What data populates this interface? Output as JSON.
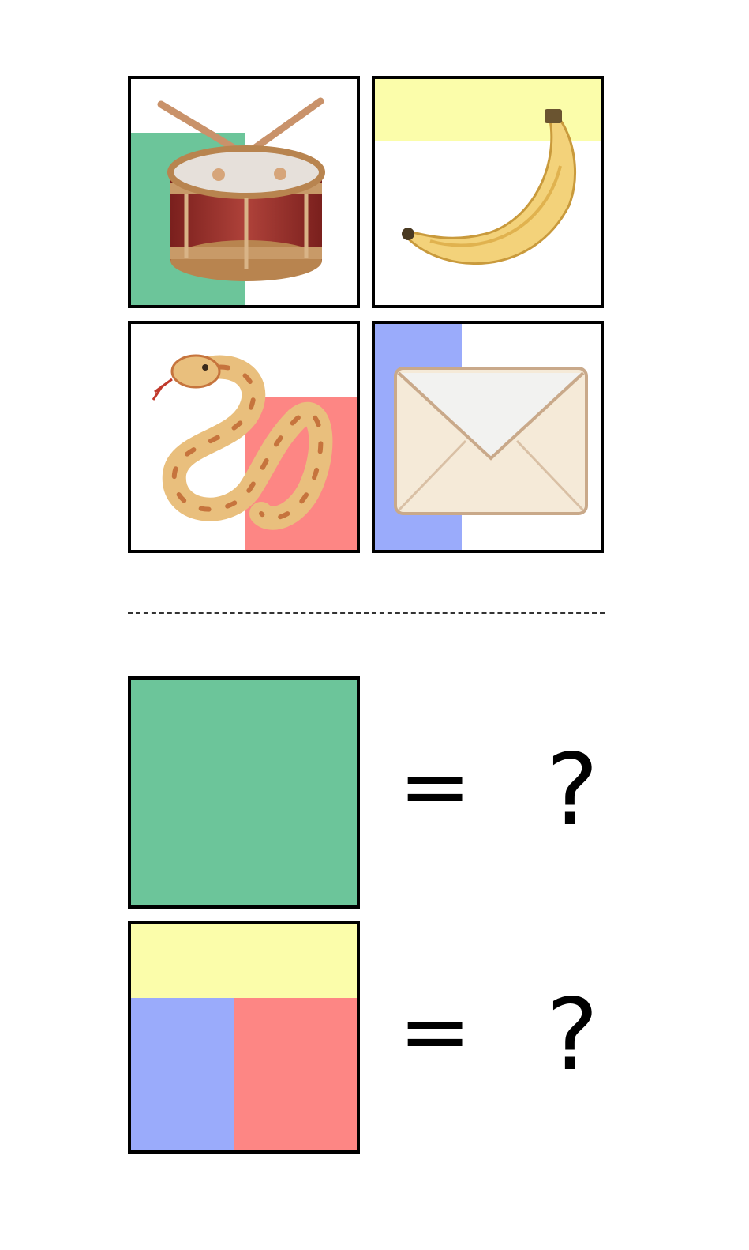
{
  "colors": {
    "green": "#6cc59a",
    "yellow": "#fbfdaa",
    "red": "#fd8684",
    "blue": "#9aabfb"
  },
  "tiles": [
    {
      "icon": "drum-icon",
      "color": "green",
      "region": "lower-left"
    },
    {
      "icon": "banana-icon",
      "color": "yellow",
      "region": "top-band"
    },
    {
      "icon": "snake-icon",
      "color": "red",
      "region": "lower-right"
    },
    {
      "icon": "envelope-icon",
      "color": "blue",
      "region": "left-band"
    }
  ],
  "equations": [
    {
      "regions": [
        "green-full"
      ],
      "equals": "=",
      "answer": "?"
    },
    {
      "regions": [
        "yellow-top",
        "blue-bottom-left",
        "red-bottom-right"
      ],
      "equals": "=",
      "answer": "?"
    }
  ]
}
